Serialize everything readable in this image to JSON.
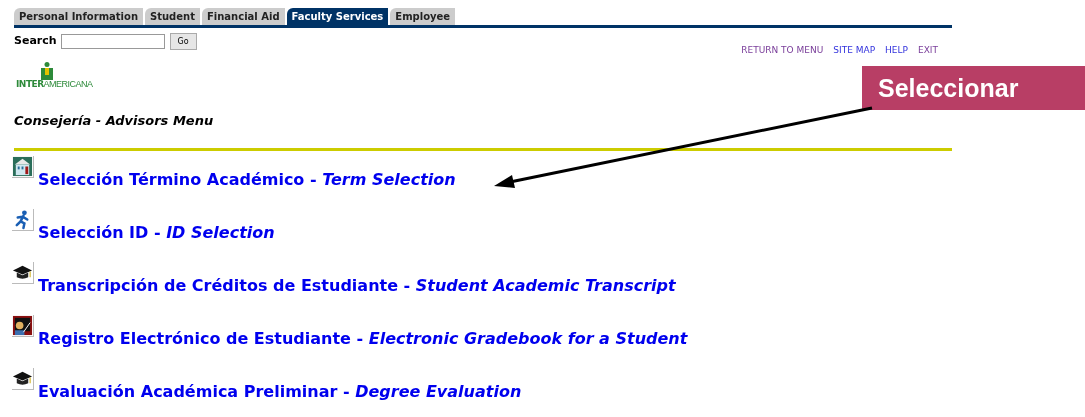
{
  "tabs": [
    {
      "label": "Personal Information",
      "selected": false
    },
    {
      "label": "Student",
      "selected": false
    },
    {
      "label": "Financial Aid",
      "selected": false
    },
    {
      "label": "Faculty Services",
      "selected": true
    },
    {
      "label": "Employee",
      "selected": false
    }
  ],
  "search": {
    "label": "Search",
    "button": "Go"
  },
  "links": [
    {
      "label": "RETURN TO MENU",
      "visited": true
    },
    {
      "label": "SITE MAP",
      "visited": false
    },
    {
      "label": "HELP",
      "visited": false
    },
    {
      "label": "EXIT",
      "visited": true
    }
  ],
  "logo": {
    "bold": "INTER",
    "light": "AMERICANA"
  },
  "heading": "Consejería - Advisors Menu",
  "menu": [
    {
      "kind": "building",
      "label": "Selección Término Académico - *Term Selection*"
    },
    {
      "kind": "runner",
      "label": "Selección ID - *ID Selection*"
    },
    {
      "kind": "cap",
      "label": "Transcripción de Créditos de Estudiante - *Student Academic Transcript*"
    },
    {
      "kind": "teacher",
      "label": "Registro Electrónico de Estudiante - *Electronic Gradebook for a Student*"
    },
    {
      "kind": "cap",
      "label": "Evaluación Académica Preliminar - *Degree Evaluation*"
    }
  ],
  "callout": {
    "label": "Seleccionar"
  }
}
